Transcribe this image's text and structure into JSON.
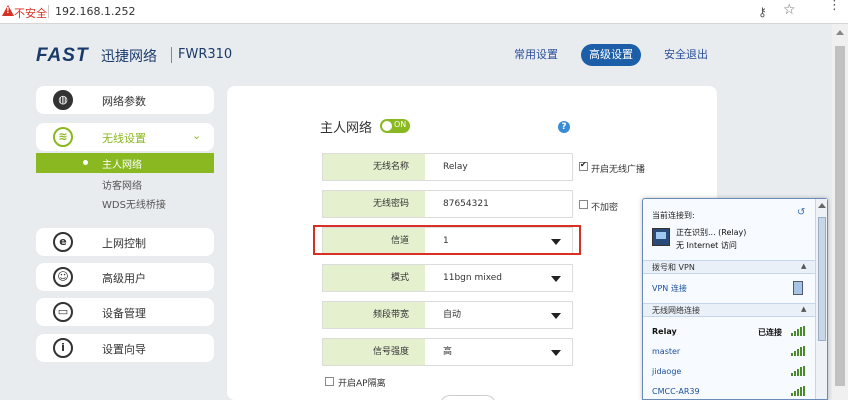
{
  "browser": {
    "insecure_label": "不安全",
    "url": "192.168.1.252"
  },
  "header": {
    "logo_brand": "FAST",
    "logo_cn": "迅捷网络",
    "model": "FWR310",
    "tabs": [
      {
        "label": "常用设置",
        "active": false
      },
      {
        "label": "高级设置",
        "active": true
      },
      {
        "label": "安全退出",
        "active": false
      }
    ]
  },
  "sidebar": {
    "items": [
      {
        "label": "网络参数",
        "icon": "globe-icon"
      },
      {
        "label": "无线设置",
        "icon": "wifi-icon"
      },
      {
        "label": "上网控制",
        "icon": "e-icon"
      },
      {
        "label": "高级用户",
        "icon": "user-icon"
      },
      {
        "label": "设备管理",
        "icon": "device-icon"
      },
      {
        "label": "设置向导",
        "icon": "info-icon"
      }
    ],
    "wireless_sub": [
      {
        "label": "主人网络",
        "active": true
      },
      {
        "label": "访客网络",
        "active": false
      },
      {
        "label": "WDS无线桥接",
        "active": false
      }
    ]
  },
  "main": {
    "title": "主人网络",
    "toggle_label": "ON",
    "help": "?",
    "rows": [
      {
        "label": "无线名称",
        "value": "Relay"
      },
      {
        "label": "无线密码",
        "value": "87654321"
      },
      {
        "label": "信道",
        "value": "1"
      },
      {
        "label": "模式",
        "value": "11bgn mixed"
      },
      {
        "label": "频段带宽",
        "value": "自动"
      },
      {
        "label": "信号强度",
        "value": "高"
      }
    ],
    "check_broadcast": "开启无线广播",
    "check_no_encrypt": "不加密",
    "check_ap_isolation": "开启AP隔离"
  },
  "wifi_popup": {
    "current_label": "当前连接到:",
    "identifying": "正在识别... (Relay)",
    "no_internet": "无 Internet 访问",
    "dialup_section": "拨号和 VPN",
    "vpn_item": "VPN 连接",
    "wireless_section": "无线网络连接",
    "networks": [
      {
        "name": "Relay",
        "status": "已连接"
      },
      {
        "name": "master",
        "status": ""
      },
      {
        "name": "jidaoge",
        "status": ""
      },
      {
        "name": "CMCC-AR39",
        "status": ""
      }
    ]
  }
}
